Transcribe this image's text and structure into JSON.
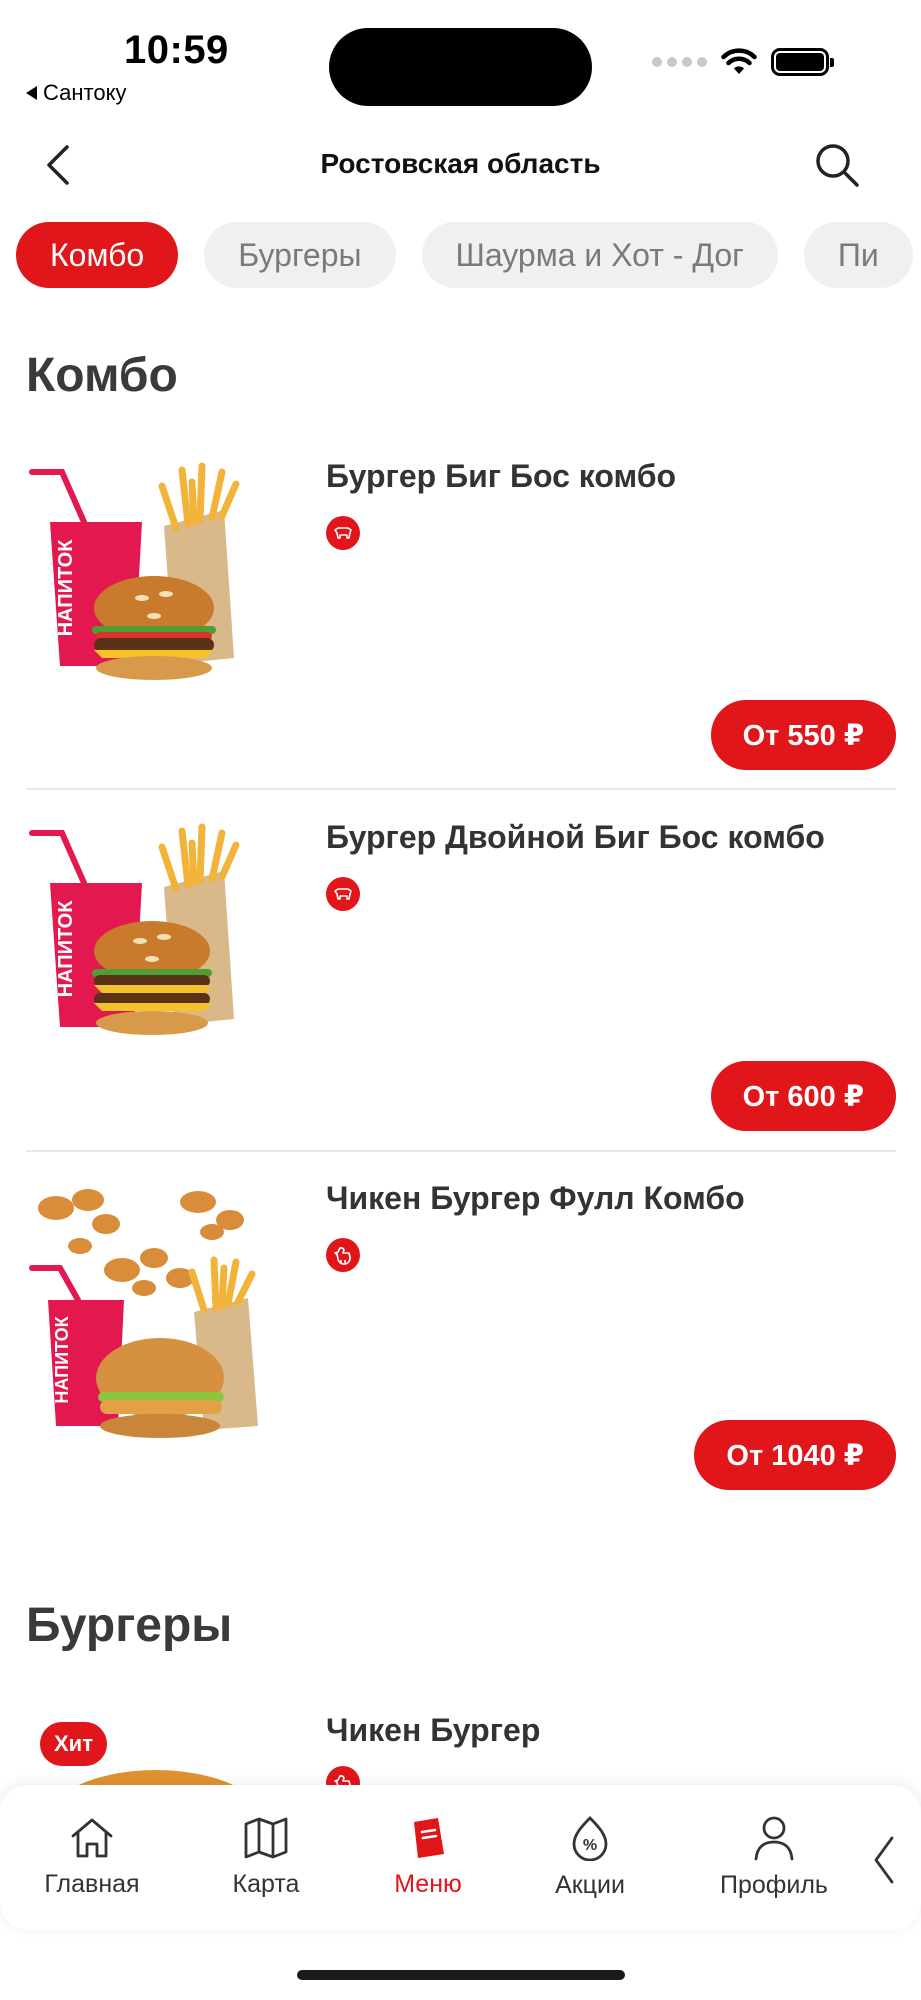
{
  "status_bar": {
    "time": "10:59",
    "back_app": "Сантоку"
  },
  "header": {
    "title": "Ростовская область"
  },
  "categories": [
    {
      "label": "Комбо",
      "active": true
    },
    {
      "label": "Бургеры",
      "active": false
    },
    {
      "label": "Шаурма и Хот - Дог",
      "active": false
    },
    {
      "label": "Пи",
      "active": false
    }
  ],
  "sections": [
    {
      "title": "Комбо",
      "items": [
        {
          "name": "Бургер Биг Бос комбо",
          "badge_icon": "cow-icon",
          "price": "От 550 ₽"
        },
        {
          "name": "Бургер Двойной Биг Бос комбо",
          "badge_icon": "cow-icon",
          "price": "От 600 ₽"
        },
        {
          "name": "Чикен Бургер Фулл Комбо",
          "badge_icon": "chicken-icon",
          "price": "От 1040 ₽"
        }
      ]
    },
    {
      "title": "Бургеры",
      "items": [
        {
          "name": "Чикен Бургер",
          "badge_icon": "chicken-icon",
          "tag": "Хит"
        }
      ]
    }
  ],
  "combo_image_text": "НАПИТОК",
  "tabbar": {
    "tabs": [
      {
        "label": "Главная",
        "icon": "home-icon",
        "active": false
      },
      {
        "label": "Карта",
        "icon": "map-icon",
        "active": false
      },
      {
        "label": "Меню",
        "icon": "menu-icon",
        "active": true
      },
      {
        "label": "Акции",
        "icon": "promo-icon",
        "active": false
      },
      {
        "label": "Профиль",
        "icon": "profile-icon",
        "active": false
      }
    ]
  },
  "colors": {
    "accent": "#e0161b",
    "chip_bg": "#f0f0f0",
    "text": "#333333"
  }
}
